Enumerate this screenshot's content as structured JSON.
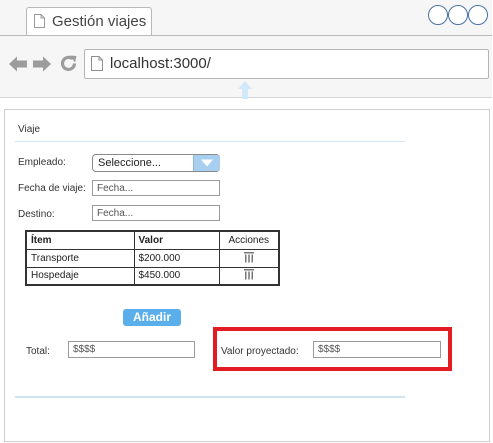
{
  "browser": {
    "tab_title": "Gestión viajes",
    "url": "localhost:3000/"
  },
  "form": {
    "section_title": "Viaje",
    "employee_label": "Empleado:",
    "employee_value": "Seleccione...",
    "date_label": "Fecha de viaje:",
    "date_placeholder": "Fecha...",
    "destination_label": "Destino:",
    "destination_placeholder": "Fecha..."
  },
  "table": {
    "headers": [
      "Ítem",
      "Valor",
      "Acciones"
    ],
    "rows": [
      {
        "item": "Transporte",
        "valor": "$200.000"
      },
      {
        "item": "Hospedaje",
        "valor": "$450.000"
      }
    ],
    "delete_icon": "trash-icon"
  },
  "add_button": "Añadir",
  "total": {
    "label": "Total:",
    "value": "$$$$"
  },
  "projected": {
    "label": "Valor proyectado:",
    "value": "$$$$"
  },
  "colors": {
    "accent": "#5aaeea",
    "window_buttons": "#4a72a8",
    "highlight": "#e31c23"
  }
}
